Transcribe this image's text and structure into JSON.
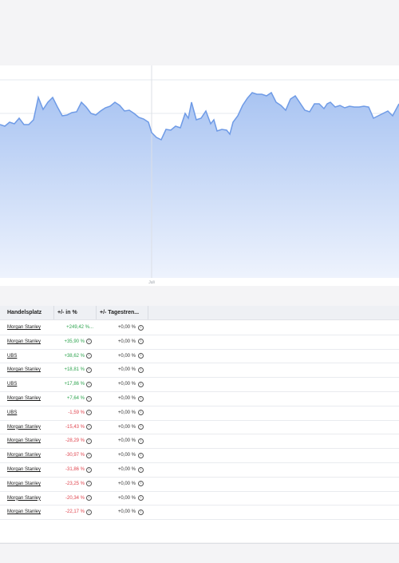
{
  "chart": {
    "x_tick_label": "Juli",
    "colors": {
      "line": "#6f9be6",
      "fill_top": "#a9c4f2",
      "fill_bottom": "#eef3fd"
    }
  },
  "table": {
    "headers": {
      "venue": "Handelsplatz",
      "perf": "+/- in %",
      "trend": "+/- Tagestren..."
    },
    "info_icon": "info-icon",
    "rows": [
      {
        "venue": "Morgan Stanley",
        "perf": "+249,42 %...",
        "trend": "+0,00 %",
        "sign": "pos",
        "perf_info": false
      },
      {
        "venue": "Morgan Stanley",
        "perf": "+35,90 %",
        "trend": "+0,00 %",
        "sign": "pos",
        "perf_info": true
      },
      {
        "venue": "UBS",
        "perf": "+38,62 %",
        "trend": "+0,00 %",
        "sign": "pos",
        "perf_info": true
      },
      {
        "venue": "Morgan Stanley",
        "perf": "+18,81 %",
        "trend": "+0,00 %",
        "sign": "pos",
        "perf_info": true
      },
      {
        "venue": "UBS",
        "perf": "+17,86 %",
        "trend": "+0,00 %",
        "sign": "pos",
        "perf_info": true
      },
      {
        "venue": "Morgan Stanley",
        "perf": "+7,64 %",
        "trend": "+0,00 %",
        "sign": "pos",
        "perf_info": true
      },
      {
        "venue": "UBS",
        "perf": "-1,59 %",
        "trend": "+0,00 %",
        "sign": "neg",
        "perf_info": true
      },
      {
        "venue": "Morgan Stanley",
        "perf": "-15,43 %",
        "trend": "+0,00 %",
        "sign": "neg",
        "perf_info": true
      },
      {
        "venue": "Morgan Stanley",
        "perf": "-28,29 %",
        "trend": "+0,00 %",
        "sign": "neg",
        "perf_info": true
      },
      {
        "venue": "Morgan Stanley",
        "perf": "-30,97 %",
        "trend": "+0,00 %",
        "sign": "neg",
        "perf_info": true
      },
      {
        "venue": "Morgan Stanley",
        "perf": "-31,86 %",
        "trend": "+0,00 %",
        "sign": "neg",
        "perf_info": true
      },
      {
        "venue": "Morgan Stanley",
        "perf": "-23,25 %",
        "trend": "+0,00 %",
        "sign": "neg",
        "perf_info": true
      },
      {
        "venue": "Morgan Stanley",
        "perf": "-20,34 %",
        "trend": "+0,00 %",
        "sign": "neg",
        "perf_info": true
      },
      {
        "venue": "Morgan Stanley",
        "perf": "-22,17 %",
        "trend": "+0,00 %",
        "sign": "neg",
        "perf_info": true
      }
    ]
  }
}
